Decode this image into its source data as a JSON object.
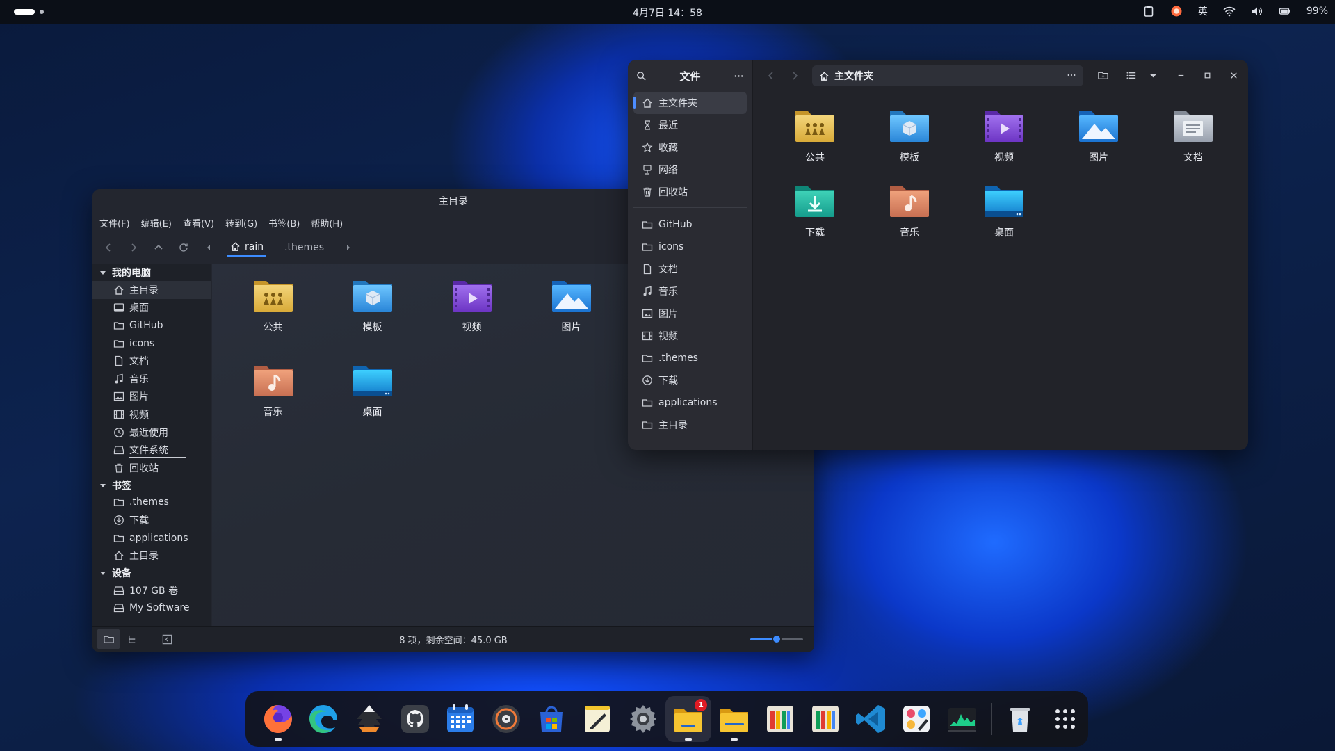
{
  "topbar": {
    "clock": "4月7日 14：58",
    "input_method": "英",
    "battery": "99%"
  },
  "nemo": {
    "title": "主目录",
    "menu": [
      "文件(F)",
      "编辑(E)",
      "查看(V)",
      "转到(G)",
      "书签(B)",
      "帮助(H)"
    ],
    "path": [
      "rain",
      ".themes"
    ],
    "sidebar": {
      "computer_header": "我的电脑",
      "computer_items": [
        "主目录",
        "桌面",
        "GitHub",
        "icons",
        "文档",
        "音乐",
        "图片",
        "视频",
        "最近使用",
        "文件系统",
        "回收站"
      ],
      "bookmarks_header": "书签",
      "bookmark_items": [
        ".themes",
        "下载",
        "applications",
        "主目录"
      ],
      "devices_header": "设备",
      "device_items": [
        "107 GB 卷",
        "My Software"
      ]
    },
    "files": [
      "公共",
      "模板",
      "视频",
      "图片",
      "音乐",
      "桌面"
    ],
    "status": "8 项，剩余空间：45.0 GB",
    "zoom_level": 0.5
  },
  "nautilus": {
    "sidebar_title": "文件",
    "places": [
      "主文件夹",
      "最近",
      "收藏",
      "网络",
      "回收站"
    ],
    "bookmarks": [
      "GitHub",
      "icons",
      "文档",
      "音乐",
      "图片",
      "视频",
      ".themes",
      "下载",
      "applications",
      "主目录"
    ],
    "location": "主文件夹",
    "files": [
      "公共",
      "模板",
      "视频",
      "图片",
      "文档",
      "下载",
      "音乐",
      "桌面"
    ]
  },
  "dock": {
    "apps": [
      "firefox",
      "edge",
      "inkscape",
      "github-desktop",
      "calendar",
      "rhythmbox",
      "software-store",
      "text-editor",
      "settings",
      "files",
      "nemo",
      "color-app-1",
      "color-app-2",
      "vscode",
      "krita",
      "system-monitor",
      "trash",
      "app-grid"
    ],
    "files_badge": "1"
  },
  "colors": {
    "accent": "#3d8cff",
    "folder_yellow": "#e7c24e",
    "folder_blue": "#3aa3e6",
    "folder_purple": "#8a4fd8",
    "folder_orange": "#d8875a",
    "folder_teal": "#1fb5a8",
    "folder_grey": "#aeb4bf"
  }
}
